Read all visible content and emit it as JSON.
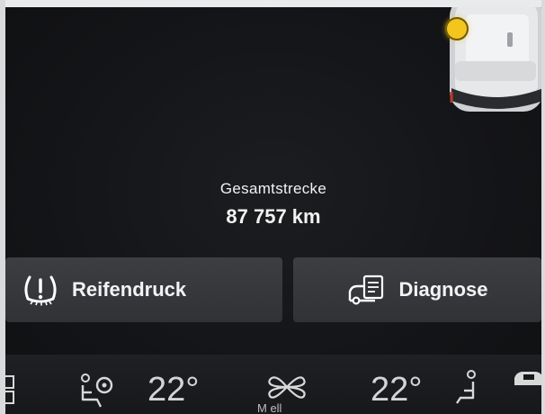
{
  "odometer": {
    "label": "Gesamtstrecke",
    "value": "87 757 km"
  },
  "apps": [
    {
      "label": "Reifendruck",
      "icon": "tire-pressure-icon"
    },
    {
      "label": "Diagnose",
      "icon": "car-diagnosis-icon"
    }
  ],
  "climate": {
    "driver_temp": "22°",
    "passenger_temp": "22°",
    "fan_label_partial": "M      ell"
  },
  "colors": {
    "warning": "#f4c51c",
    "button_bg": "#37393d",
    "text": "#f2f2f2"
  }
}
